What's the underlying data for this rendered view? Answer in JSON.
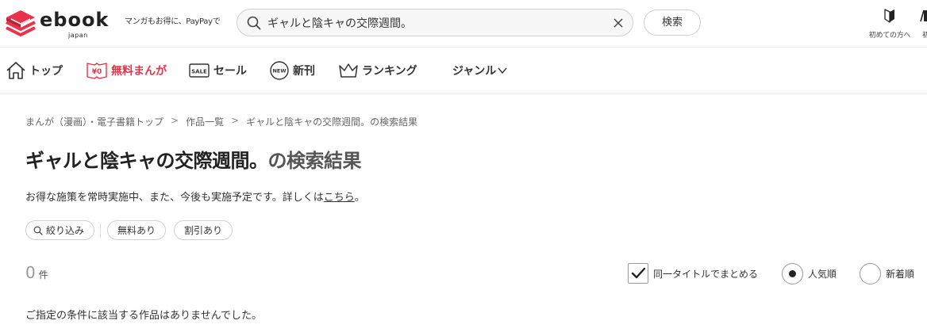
{
  "header": {
    "logo_text": "ebook",
    "logo_sub": "japan",
    "tagline": "マンガもお得に、PayPayで",
    "search_value": "ギャルと陰キャの交際週間。",
    "search_button": "検索",
    "beginner_label": "初めての方へ",
    "edge_label": "初",
    "icons": {
      "logo": "book-stack-logo-icon",
      "search": "search-icon",
      "clear": "close-icon",
      "beginner": "beginner-mark-icon"
    },
    "brand_color": "#e8334a"
  },
  "nav": {
    "items": [
      {
        "label": "トップ",
        "icon": "home-icon"
      },
      {
        "label": "無料まんが",
        "icon": "free-yen-icon",
        "badge": "¥0"
      },
      {
        "label": "セール",
        "icon": "sale-tag-icon",
        "badge": "SALE"
      },
      {
        "label": "新刊",
        "icon": "new-badge-icon",
        "badge": "NEW"
      },
      {
        "label": "ランキング",
        "icon": "crown-icon"
      },
      {
        "label": "ジャンル",
        "icon": "chevron-down-icon"
      }
    ]
  },
  "breadcrumb": {
    "items": [
      "まんが（漫画）・電子書籍トップ",
      "作品一覧",
      "ギャルと陰キャの交際週間。の検索結果"
    ],
    "separator": ">"
  },
  "title": {
    "query": "ギャルと陰キャの交際週間。",
    "suffix": "の検索結果"
  },
  "notice": {
    "text": "お得な施策を常時実施中、また、今後も実施予定です。詳しくは",
    "link": "こちら",
    "end": "。"
  },
  "filters": {
    "narrow": "絞り込み",
    "free": "無料あり",
    "discount": "割引あり"
  },
  "results": {
    "count": "0",
    "unit": "件",
    "same_title_label": "同一タイトルでまとめる",
    "same_title_checked": true,
    "sort_popular": "人気順",
    "sort_newest": "新着順",
    "selected_sort": "人気順",
    "empty_message": "ご指定の条件に該当する作品はありませんでした。"
  }
}
